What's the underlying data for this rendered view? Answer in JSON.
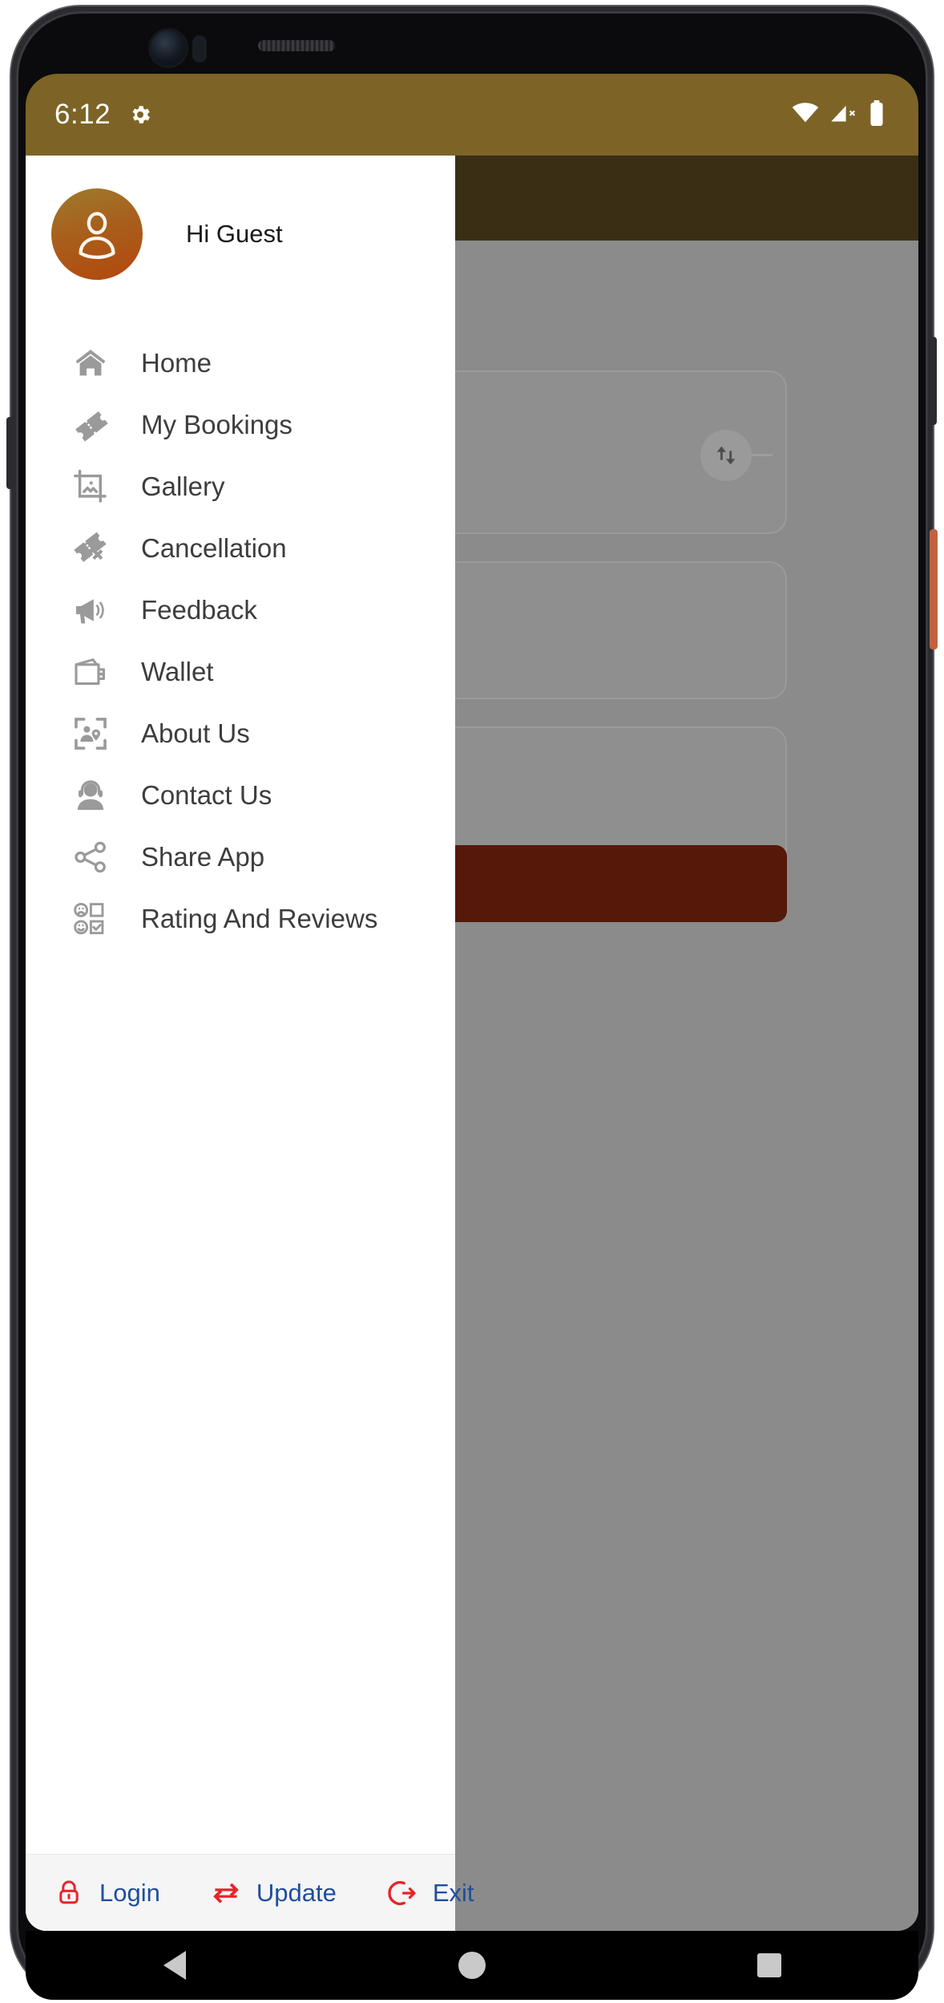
{
  "status_bar": {
    "clock": "6:12",
    "settings_icon": "gear-icon",
    "wifi_icon": "wifi-icon",
    "signal_icon": "cellular-signal-off-icon",
    "battery_icon": "battery-icon",
    "background_color": "#7D6426",
    "text_color": "#FFFFFF"
  },
  "drawer": {
    "header": {
      "greeting": "Hi Guest",
      "avatar_icon": "user-avatar-icon",
      "avatar_gradient_from": "#9D7B2C",
      "avatar_gradient_to": "#B4470D"
    },
    "menu_items": [
      {
        "label": "Home",
        "icon": "home-icon"
      },
      {
        "label": "My Bookings",
        "icon": "ticket-icon"
      },
      {
        "label": "Gallery",
        "icon": "image-crop-icon"
      },
      {
        "label": "Cancellation",
        "icon": "ticket-cancel-icon"
      },
      {
        "label": "Feedback",
        "icon": "megaphone-icon"
      },
      {
        "label": "Wallet",
        "icon": "wallet-icon"
      },
      {
        "label": "About Us",
        "icon": "person-location-frame-icon"
      },
      {
        "label": "Contact Us",
        "icon": "headset-support-icon"
      },
      {
        "label": "Share App",
        "icon": "share-nodes-icon"
      },
      {
        "label": "Rating And Reviews",
        "icon": "rating-review-icon"
      }
    ],
    "actions": [
      {
        "label": "Login",
        "icon": "lock-icon"
      },
      {
        "label": "Update",
        "icon": "sync-arrows-icon"
      },
      {
        "label": "Exit",
        "icon": "exit-arrow-icon"
      }
    ],
    "action_icon_color": "#E8232A",
    "action_label_color": "#1F4E9C",
    "background_color": "#FFFFFF",
    "actions_background_color": "#F5F5F5"
  },
  "background_screen": {
    "app_bar_color": "#3A2F15",
    "scrim_color": "#8B8B8B",
    "primary_button_color": "#55190A",
    "swap_icon": "swap-vertical-icon"
  },
  "nav_bar": {
    "back_icon": "back-triangle-icon",
    "home_icon": "home-circle-icon",
    "recents_icon": "recents-square-icon",
    "background_color": "#000000"
  }
}
